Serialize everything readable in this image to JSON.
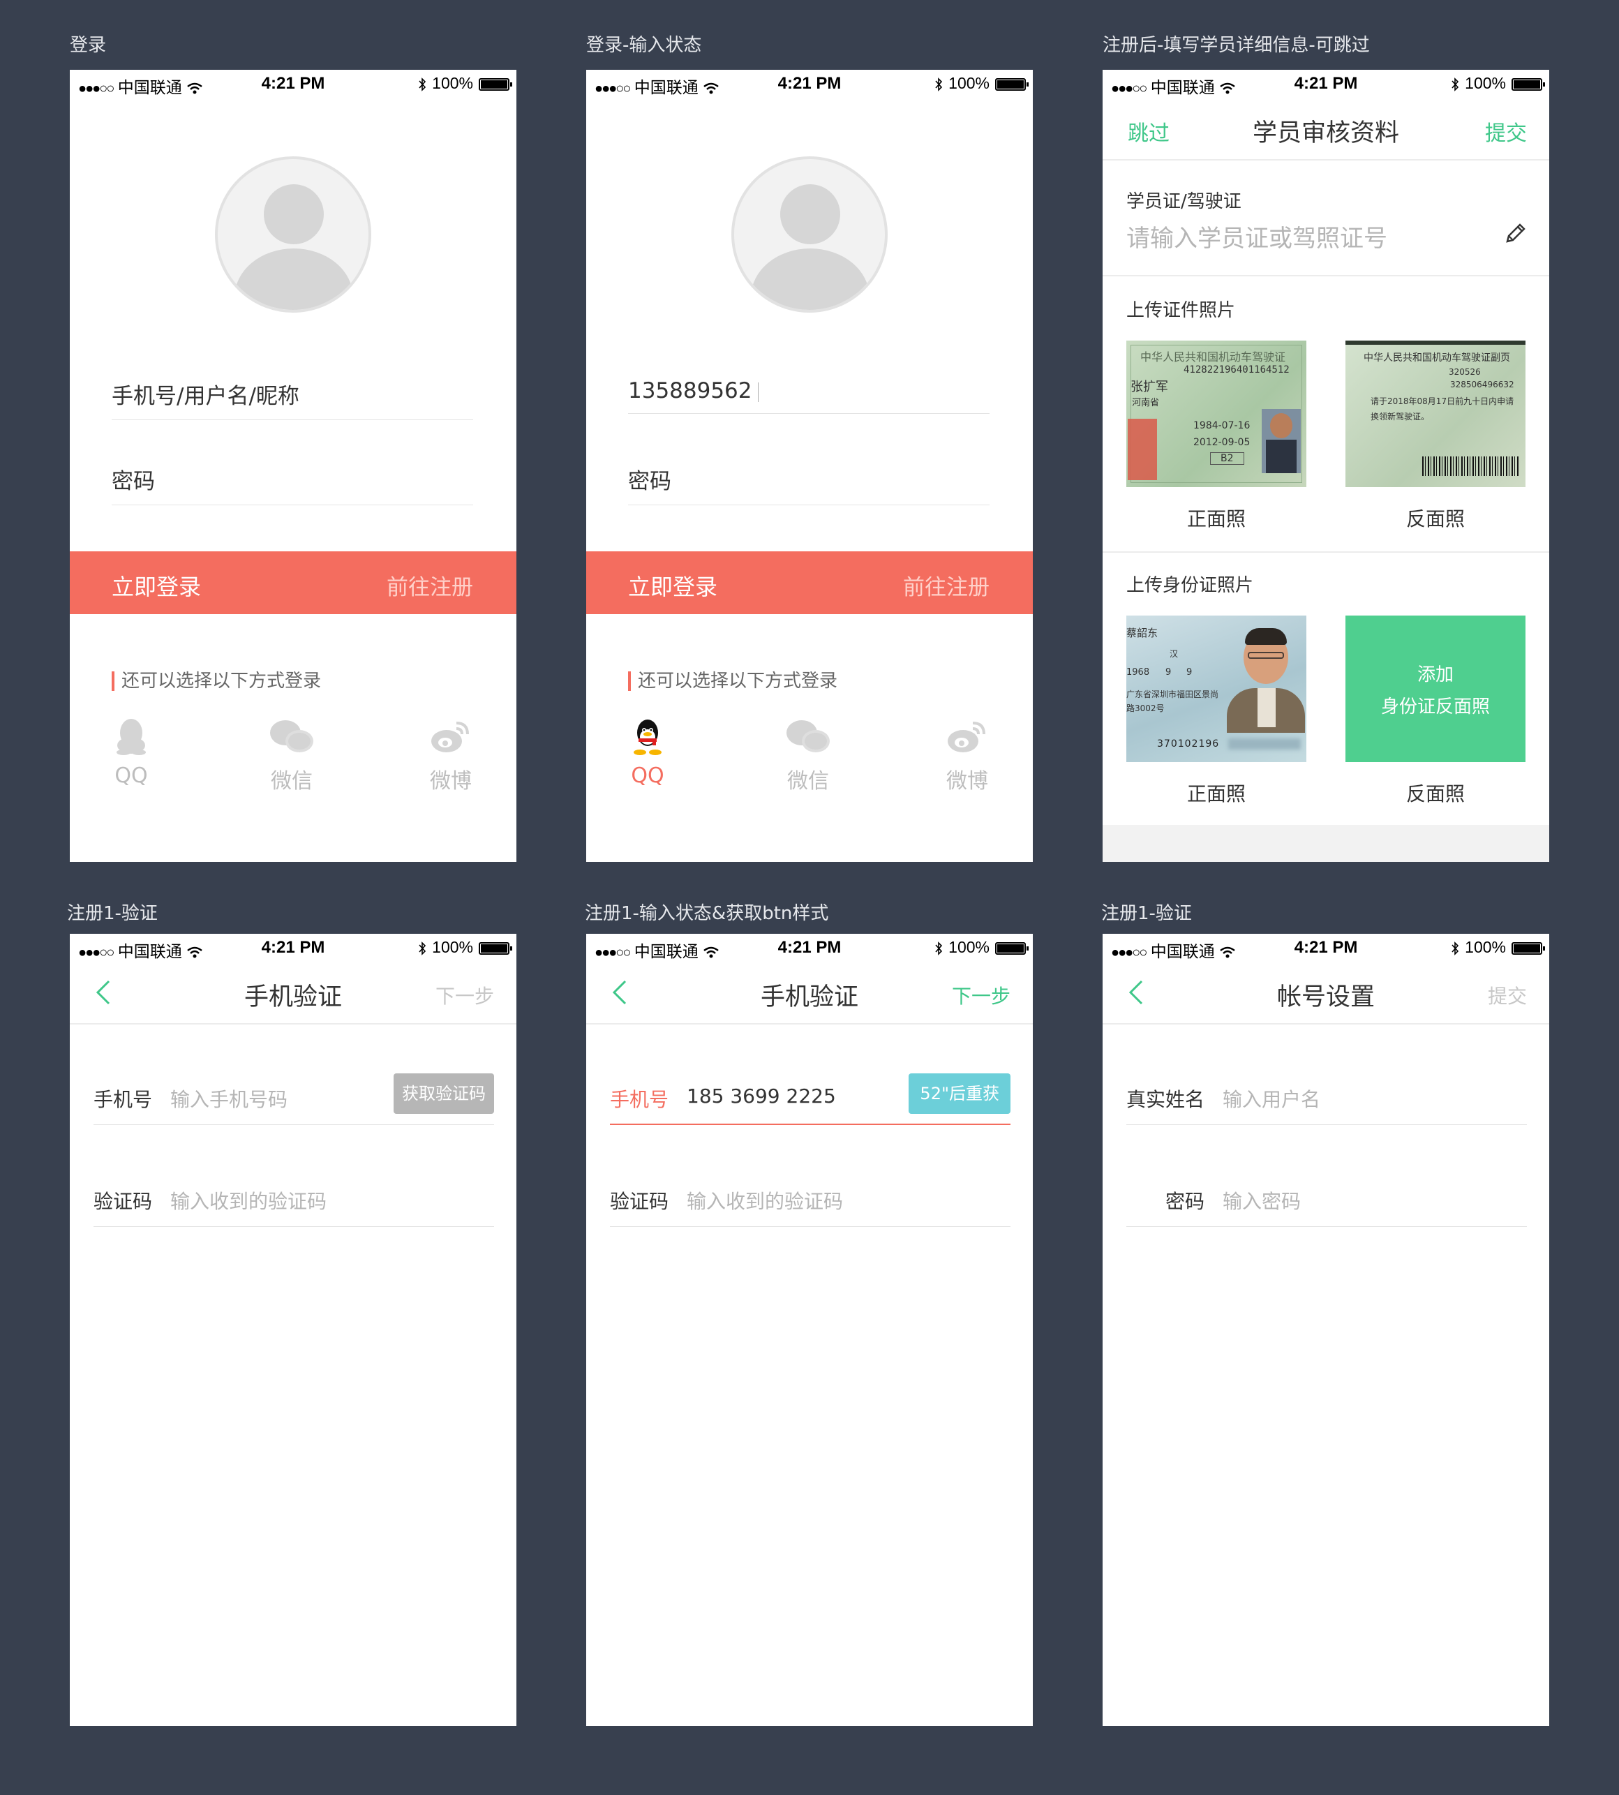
{
  "status_bar": {
    "dots": "●●●○○",
    "carrier": "中国联通",
    "time": "4:21 PM",
    "battery": "100%"
  },
  "captions": [
    "登录",
    "登录-输入状态",
    "注册后-填写学员详细信息-可跳过",
    "注册1-验证",
    "注册1-输入状态&获取btn样式",
    "注册1-验证"
  ],
  "login": {
    "username_placeholder": "手机号/用户名/昵称",
    "username_value": "135889562",
    "password_placeholder": "密码",
    "login_button": "立即登录",
    "register_link": "前往注册",
    "alt_title": "还可以选择以下方式登录",
    "social": [
      "QQ",
      "微信",
      "微博"
    ]
  },
  "review": {
    "skip": "跳过",
    "title": "学员审核资料",
    "submit": "提交",
    "license_label": "学员证/驾驶证",
    "license_placeholder": "请输入学员证或驾照证号",
    "upload_cert_title": "上传证件照片",
    "upload_id_title": "上传身份证照片",
    "front": "正面照",
    "back": "反面照",
    "add_id_back_line1": "添加",
    "add_id_back_line2": "身份证反面照",
    "license_front_text": [
      "中华人民共和国机动车驾驶证",
      "412822196401164512",
      "张扩军",
      "河南省",
      "1984-07-16",
      "2012-09-05",
      "B2"
    ],
    "license_back_text": [
      "中华人民共和国机动车驾驶证副页",
      "320526",
      "328506496632",
      "请于2018年08月17日前九十日内申请",
      "换领新驾驶证。"
    ],
    "id_front_text": [
      "蔡韶东",
      "汉",
      "1968",
      "9",
      "9",
      "广东省深圳市福田区景尚",
      "路3002号",
      "370102196"
    ]
  },
  "verify": {
    "title": "手机验证",
    "next": "下一步",
    "phone_label": "手机号",
    "phone_placeholder": "输入手机号码",
    "phone_value": "185 3699 2225",
    "get_code": "获取验证码",
    "resend": "52\"后重获",
    "code_label": "验证码",
    "code_placeholder": "输入收到的验证码"
  },
  "account": {
    "title": "帐号设置",
    "submit": "提交",
    "name_label": "真实姓名",
    "name_placeholder": "输入用户名",
    "password_label": "密码",
    "password_placeholder": "输入密码"
  },
  "colors": {
    "accent_red": "#f46d5f",
    "accent_green": "#3fc789",
    "resend_blue": "#6ccfd9",
    "get_code_gray": "#b6b6b6",
    "page_bg": "#38404f"
  }
}
